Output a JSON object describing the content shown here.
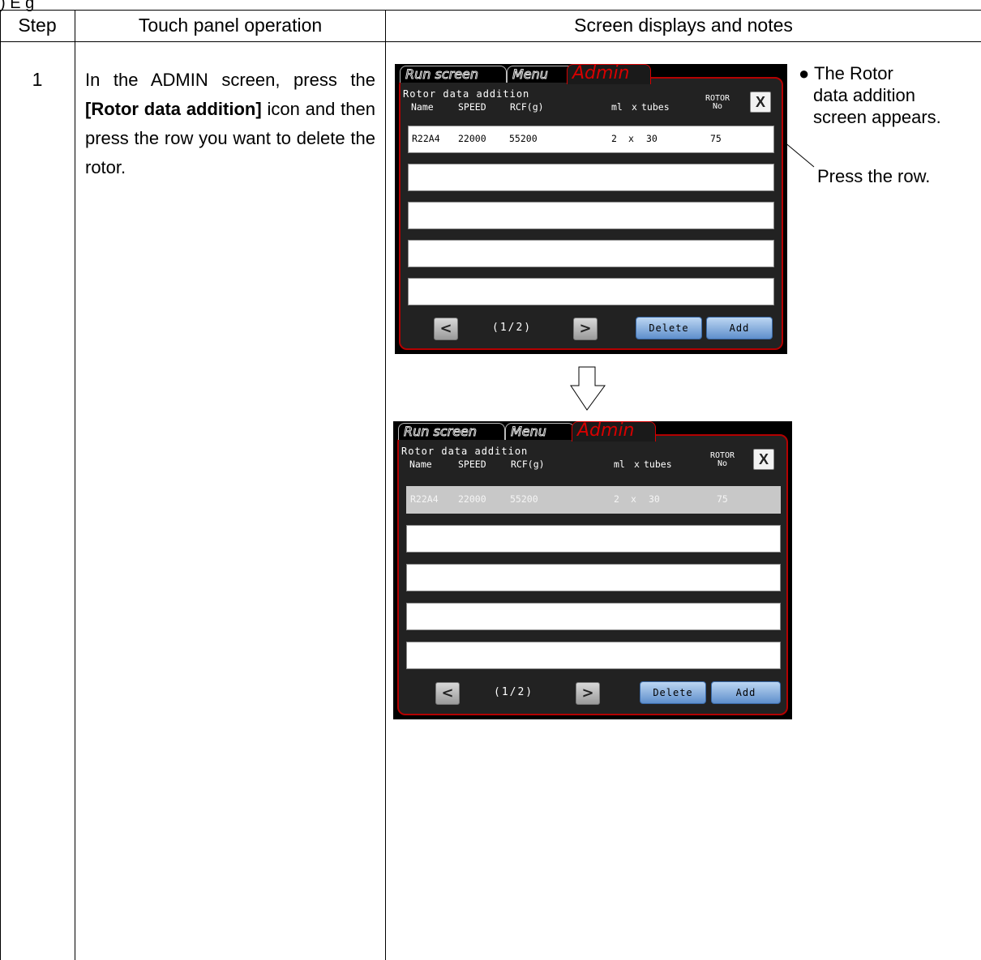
{
  "top_fragment": ") E  g",
  "table": {
    "headers": {
      "step": "Step",
      "operation": "Touch panel operation",
      "notes": "Screen displays and notes"
    }
  },
  "step": {
    "number": "1",
    "desc_before": "In the ADMIN screen, press the ",
    "desc_bold": "[Rotor data addition]",
    "desc_after": " icon and then press the row you want to delete the rotor."
  },
  "notes": {
    "bullet": "● The Rotor",
    "line2": "data addition",
    "line3": "screen appears.",
    "callout": "Press the row."
  },
  "screen": {
    "tabs": [
      "Run screen",
      "Menu",
      "Admin"
    ],
    "title": "Rotor data addition",
    "columns": {
      "name": "Name",
      "speed": "SPEED",
      "rcf": "RCF(g)",
      "ml": "ml",
      "x": "x",
      "tubes": "tubes",
      "rotor": "ROTOR",
      "no": "No"
    },
    "close": "X",
    "row": {
      "name": "R22A4",
      "speed": "22000",
      "rcf": "55200",
      "ml": "2",
      "x": "x",
      "tubes": "30",
      "no": "75"
    },
    "prev": "<",
    "next": ">",
    "pager": "(1/2)",
    "delete": "Delete",
    "add": "Add",
    "border_color": "#b40000",
    "selected_row_color": "#c8c8c8"
  }
}
